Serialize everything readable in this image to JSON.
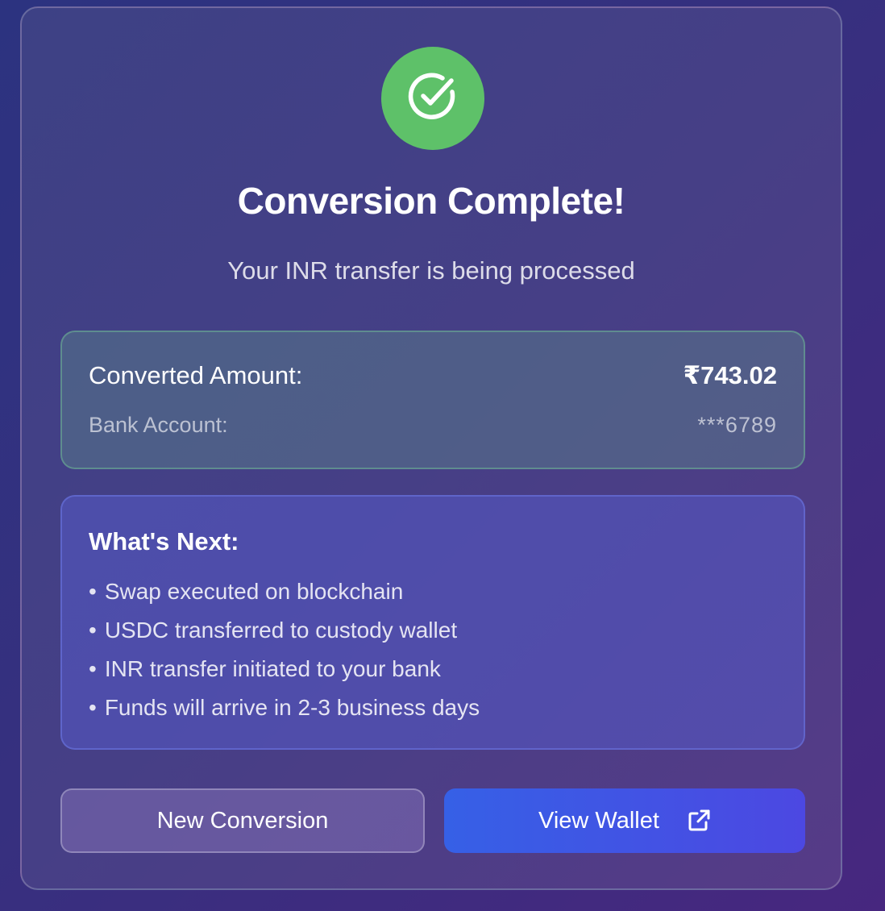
{
  "status": {
    "icon": "check-circle-icon",
    "title": "Conversion Complete!",
    "subtitle": "Your INR transfer is being processed",
    "color": "#5ec169"
  },
  "summary": {
    "converted_label": "Converted Amount:",
    "converted_value": "₹743.02",
    "bank_label": "Bank Account:",
    "bank_value": "***6789"
  },
  "next": {
    "title": "What's Next:",
    "items": [
      "Swap executed on blockchain",
      "USDC transferred to custody wallet",
      "INR transfer initiated to your bank",
      "Funds will arrive in 2-3 business days"
    ]
  },
  "actions": {
    "new_conversion_label": "New Conversion",
    "view_wallet_label": "View Wallet",
    "view_wallet_icon": "external-link-icon",
    "accent": "#3b5de6"
  }
}
